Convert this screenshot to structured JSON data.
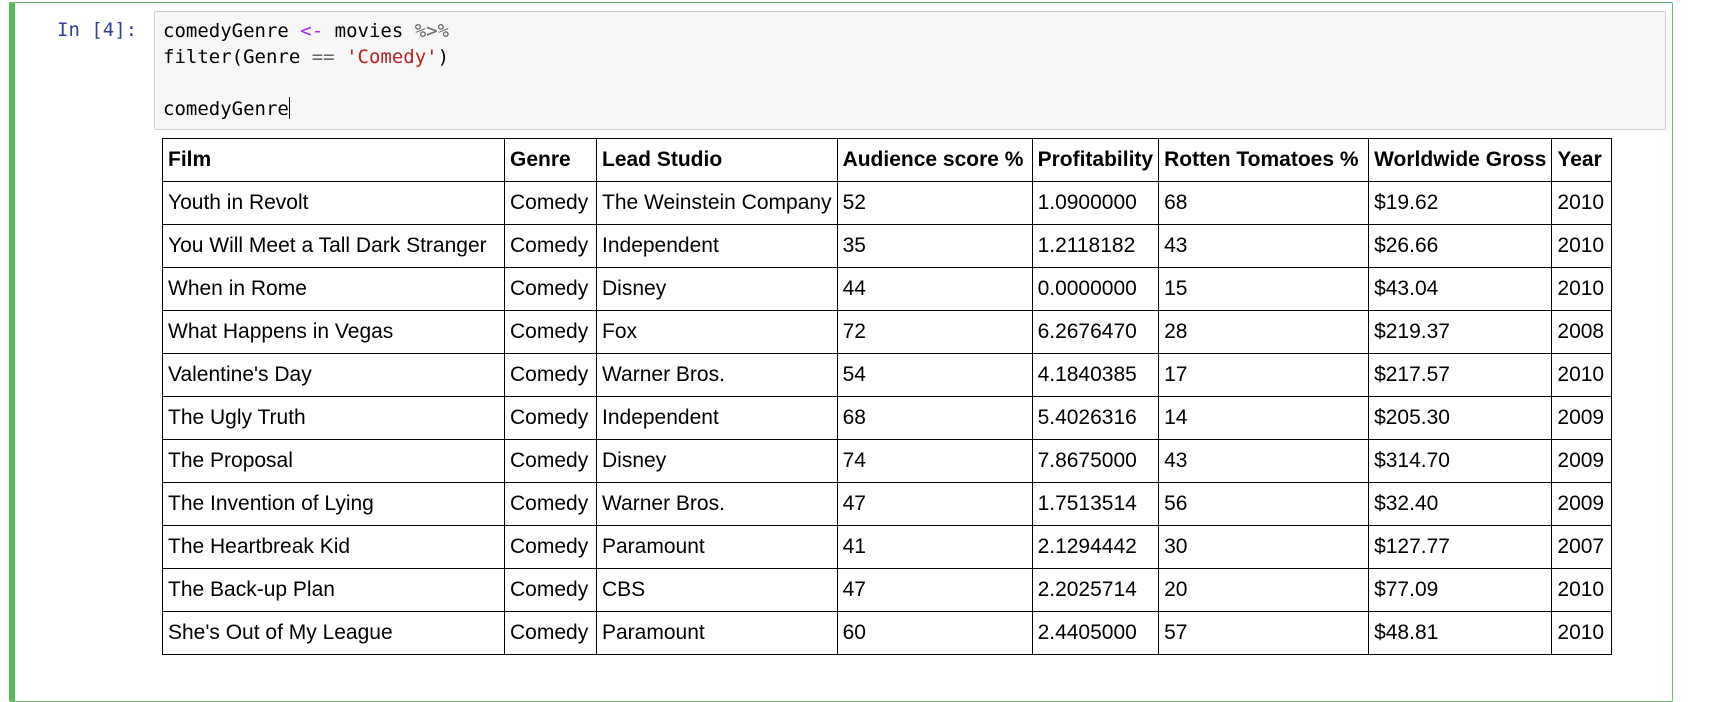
{
  "cell": {
    "prompt": "In [4]:",
    "code": {
      "line1_var": "comedyGenre",
      "line1_assign": "<-",
      "line1_obj": "movies",
      "line1_pipe": "%>%",
      "line2_func": "filter(Genre",
      "line2_eq": "==",
      "line2_str": "'Comedy'",
      "line2_close": ")",
      "line4": "comedyGenre"
    }
  },
  "table": {
    "headers": [
      "Film",
      "Genre",
      "Lead Studio",
      "Audience score %",
      "Profitability",
      "Rotten Tomatoes %",
      "Worldwide Gross",
      "Year"
    ],
    "rows": [
      [
        "Youth in Revolt",
        "Comedy",
        "The Weinstein Company",
        "52",
        "1.0900000",
        "68",
        "$19.62",
        "2010"
      ],
      [
        "You Will Meet a Tall Dark Stranger",
        "Comedy",
        "Independent",
        "35",
        "1.2118182",
        "43",
        "$26.66",
        "2010"
      ],
      [
        "When in Rome",
        "Comedy",
        "Disney",
        "44",
        "0.0000000",
        "15",
        "$43.04",
        "2010"
      ],
      [
        "What Happens in Vegas",
        "Comedy",
        "Fox",
        "72",
        "6.2676470",
        "28",
        "$219.37",
        "2008"
      ],
      [
        "Valentine's Day",
        "Comedy",
        "Warner Bros.",
        "54",
        "4.1840385",
        "17",
        "$217.57",
        "2010"
      ],
      [
        "The Ugly Truth",
        "Comedy",
        "Independent",
        "68",
        "5.4026316",
        "14",
        "$205.30",
        "2009"
      ],
      [
        "The Proposal",
        "Comedy",
        "Disney",
        "74",
        "7.8675000",
        "43",
        "$314.70",
        "2009"
      ],
      [
        "The Invention of Lying",
        "Comedy",
        "Warner Bros.",
        "47",
        "1.7513514",
        "56",
        "$32.40",
        "2009"
      ],
      [
        "The Heartbreak Kid",
        "Comedy",
        "Paramount",
        "41",
        "2.1294442",
        "30",
        "$127.77",
        "2007"
      ],
      [
        "The Back-up Plan",
        "Comedy",
        "CBS",
        "47",
        "2.2025714",
        "20",
        "$77.09",
        "2010"
      ],
      [
        "She's Out of My League",
        "Comedy",
        "Paramount",
        "60",
        "2.4405000",
        "57",
        "$48.81",
        "2010"
      ]
    ]
  }
}
